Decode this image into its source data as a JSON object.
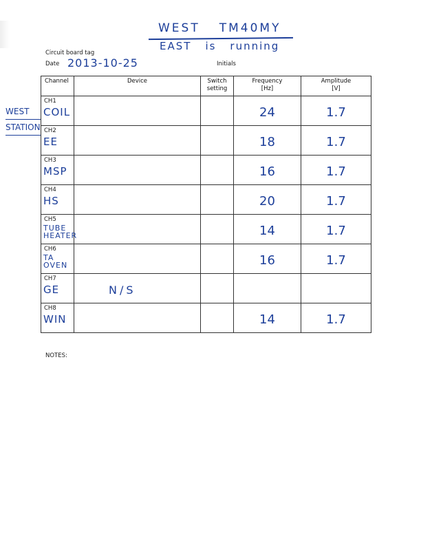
{
  "header_note": {
    "line1_left": "WEST",
    "line1_right": "TM40MY",
    "line2_left": "EAST",
    "line2_mid": "is",
    "line2_right": "running"
  },
  "form": {
    "circuit_board_tag_label": "Circuit board tag",
    "date_label": "Date",
    "date_value": "2013-10-25",
    "initials_label": "Initials",
    "notes_label": "NOTES:"
  },
  "margin_note": {
    "line1": "WEST",
    "line2": "STATION"
  },
  "table": {
    "headers": {
      "channel": "Channel",
      "device": "Device",
      "switch_line1": "Switch",
      "switch_line2": "setting",
      "frequency_line1": "Frequency",
      "frequency_line2": "[Hz]",
      "amplitude_line1": "Amplitude",
      "amplitude_line2": "[V]"
    },
    "rows": [
      {
        "channel": "CH1",
        "name": "COIL",
        "name2": "",
        "device_note": "",
        "switch": "",
        "frequency": "24",
        "amplitude": "1.7"
      },
      {
        "channel": "CH2",
        "name": "EE",
        "name2": "",
        "device_note": "",
        "switch": "",
        "frequency": "18",
        "amplitude": "1.7"
      },
      {
        "channel": "CH3",
        "name": "MSP",
        "name2": "",
        "device_note": "",
        "switch": "",
        "frequency": "16",
        "amplitude": "1.7"
      },
      {
        "channel": "CH4",
        "name": "HS",
        "name2": "",
        "device_note": "",
        "switch": "",
        "frequency": "20",
        "amplitude": "1.7"
      },
      {
        "channel": "CH5",
        "name": "TUBE",
        "name2": "HEATER",
        "device_note": "",
        "switch": "",
        "frequency": "14",
        "amplitude": "1.7"
      },
      {
        "channel": "CH6",
        "name": "TA",
        "name2": "OVEN",
        "device_note": "",
        "switch": "",
        "frequency": "16",
        "amplitude": "1.7"
      },
      {
        "channel": "CH7",
        "name": "GE",
        "name2": "",
        "device_note": "N/S",
        "switch": "",
        "frequency": "",
        "amplitude": ""
      },
      {
        "channel": "CH8",
        "name": "WIN",
        "name2": "",
        "device_note": "",
        "switch": "",
        "frequency": "14",
        "amplitude": "1.7"
      }
    ]
  }
}
